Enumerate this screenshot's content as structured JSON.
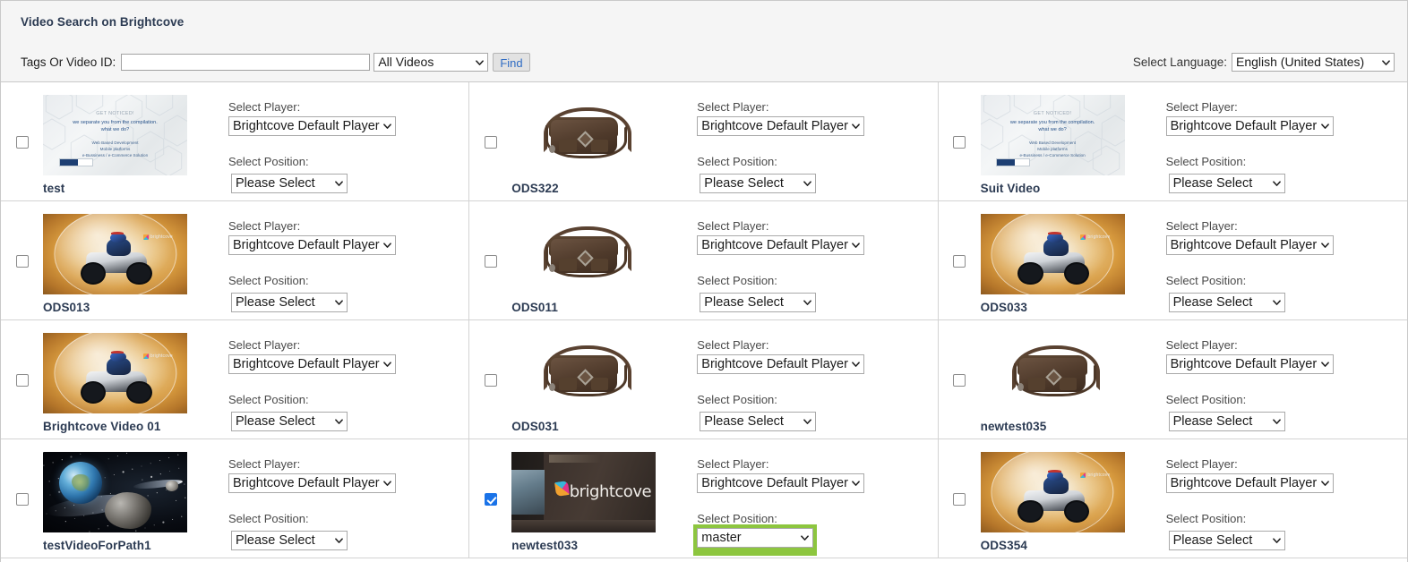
{
  "panel": {
    "title": "Video Search on Brightcove",
    "search_label": "Tags Or Video ID:",
    "search_value": "",
    "search_placeholder": "",
    "scope_value": "All Videos",
    "find_label": "Find",
    "language_label": "Select Language:",
    "language_value": "English (United States)"
  },
  "labels": {
    "player": "Select Player:",
    "position": "Select Position:"
  },
  "defaults": {
    "player": "Brightcove Default Player",
    "position": "Please Select"
  },
  "videos": [
    {
      "name": "test",
      "checked": false,
      "player": "Brightcove Default Player",
      "position": "Please Select",
      "highlighted": false,
      "art": "corporate-slide",
      "thumb_text": {
        "t1": "GET NOTICED!",
        "t2": "we separate you from the compilation.<br>what we do?",
        "t3": "Web Based Development<br>Mobile platforms<br>e-Bussiness / e-Commerce Solution"
      }
    },
    {
      "name": "ODS322",
      "checked": false,
      "player": "Brightcove Default Player",
      "position": "Please Select",
      "highlighted": false,
      "art": "leather-bag"
    },
    {
      "name": "Suit Video",
      "checked": false,
      "player": "Brightcove Default Player",
      "position": "Please Select",
      "highlighted": false,
      "art": "corporate-slide",
      "thumb_text": {
        "t1": "GET NOTICED!",
        "t2": "we separate you from the compilation.<br>what we do?",
        "t3": "Web Based Development<br>Mobile platforms<br>e-Bussiness / e-Commerce Solution"
      }
    },
    {
      "name": "ODS013",
      "checked": false,
      "player": "Brightcove Default Player",
      "position": "Please Select",
      "highlighted": false,
      "art": "atv-bubble"
    },
    {
      "name": "ODS011",
      "checked": false,
      "player": "Brightcove Default Player",
      "position": "Please Select",
      "highlighted": false,
      "art": "leather-bag"
    },
    {
      "name": "ODS033",
      "checked": false,
      "player": "Brightcove Default Player",
      "position": "Please Select",
      "highlighted": false,
      "art": "atv-bubble"
    },
    {
      "name": "Brightcove Video 01",
      "checked": false,
      "player": "Brightcove Default Player",
      "position": "Please Select",
      "highlighted": false,
      "art": "atv-bubble"
    },
    {
      "name": "ODS031",
      "checked": false,
      "player": "Brightcove Default Player",
      "position": "Please Select",
      "highlighted": false,
      "art": "leather-bag"
    },
    {
      "name": "newtest035",
      "checked": false,
      "player": "Brightcove Default Player",
      "position": "Please Select",
      "highlighted": false,
      "art": "leather-bag"
    },
    {
      "name": "testVideoForPath1",
      "checked": false,
      "player": "Brightcove Default Player",
      "position": "Please Select",
      "highlighted": false,
      "art": "space-asteroid"
    },
    {
      "name": "newtest033",
      "checked": true,
      "player": "Brightcove Default Player",
      "position": "master",
      "highlighted": true,
      "art": "brightcove-office",
      "thumb_text": {
        "t1": "brightcove"
      }
    },
    {
      "name": "ODS354",
      "checked": false,
      "player": "Brightcove Default Player",
      "position": "Please Select",
      "highlighted": false,
      "art": "atv-bubble"
    }
  ],
  "colors": {
    "highlight": "#8dc63f",
    "checkbox_checked": "#1a73e8",
    "title_text": "#2b3a52",
    "panel_bg": "#f5f5f5",
    "find_text": "#2f6cc4"
  },
  "icons": {
    "caret": "chevron-down-icon"
  }
}
